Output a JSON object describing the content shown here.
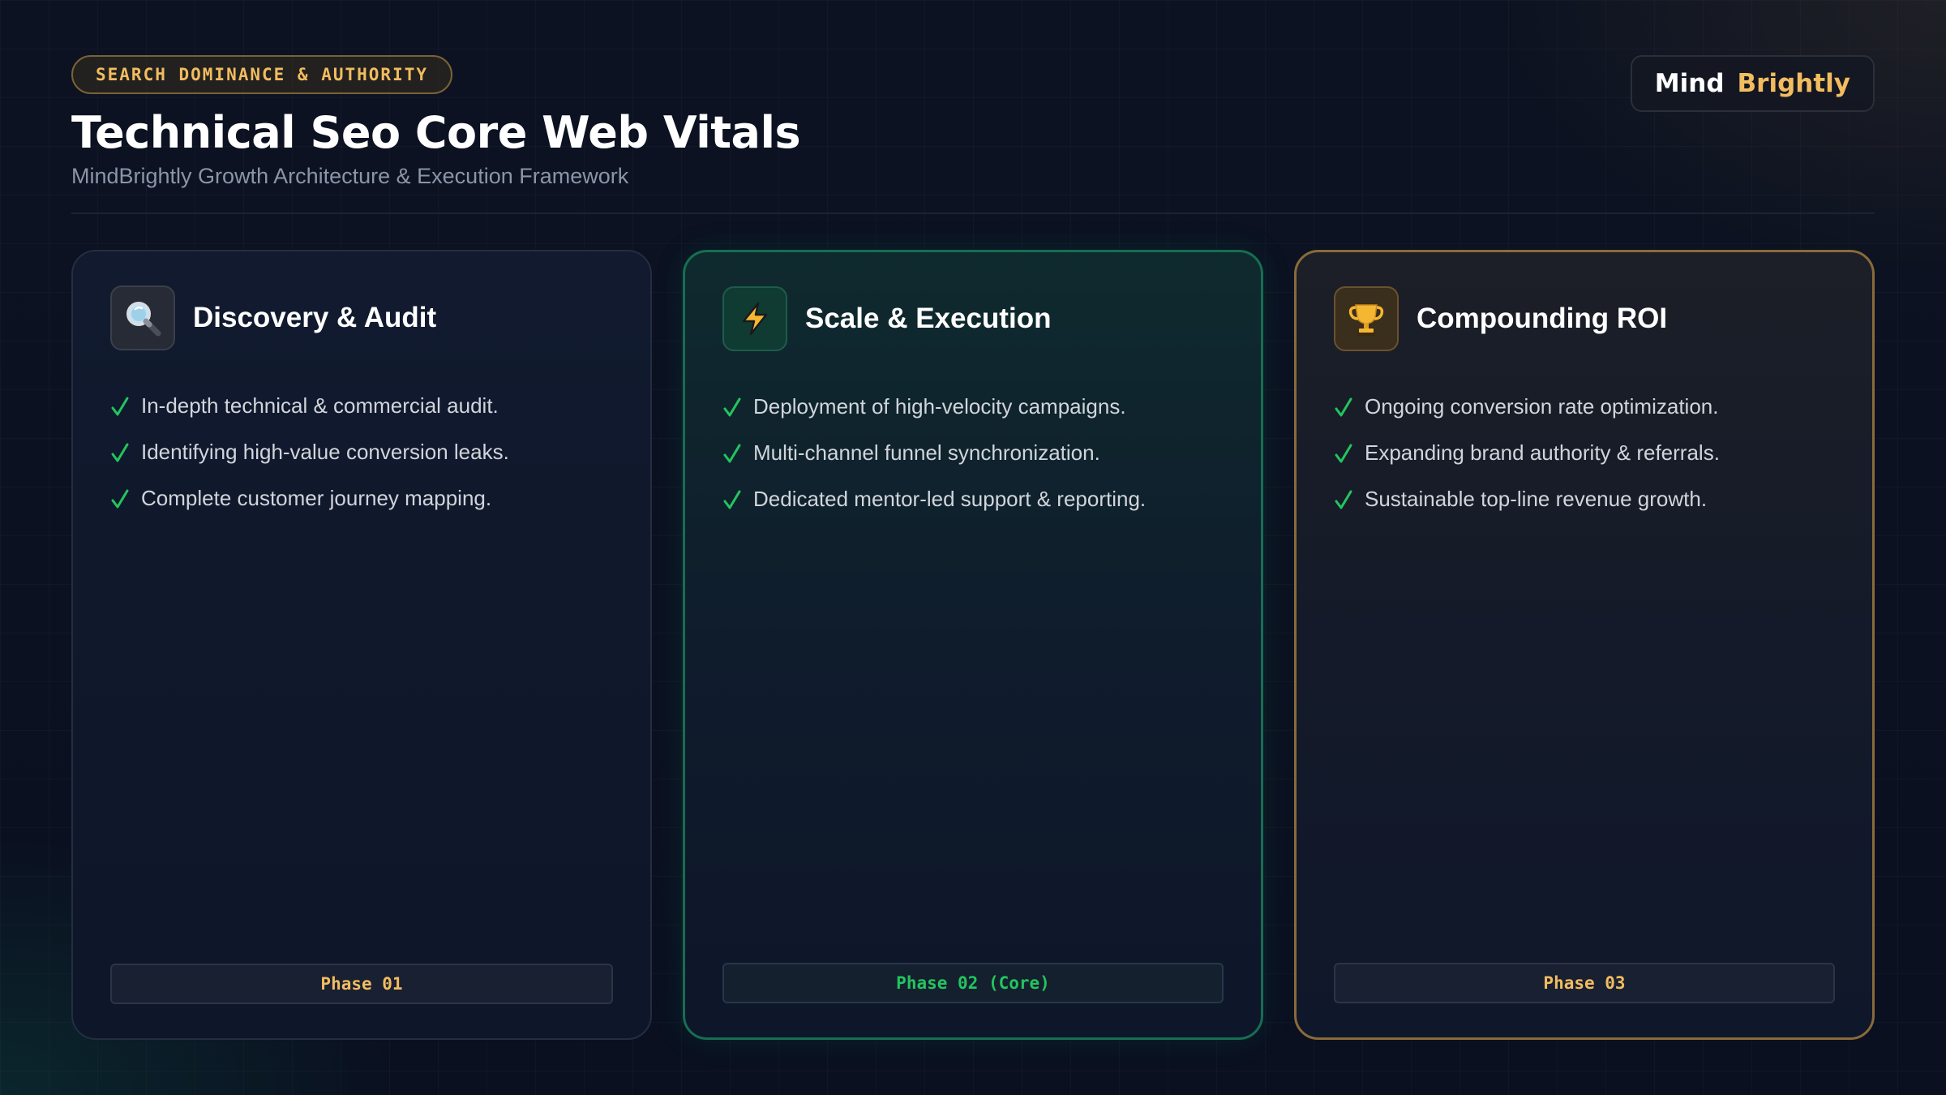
{
  "header": {
    "kicker": "SEARCH DOMINANCE & AUTHORITY",
    "title": "Technical Seo Core Web Vitals",
    "subtitle": "MindBrightly Growth Architecture & Execution Framework"
  },
  "logo": {
    "word1": "Mind",
    "word2": "Brightly"
  },
  "colors": {
    "accent_gold": "#f2bc5f",
    "accent_green": "#22c55e",
    "background": "#0b1120"
  },
  "cards": [
    {
      "icon": "magnifying-glass-icon",
      "title": "Discovery & Audit",
      "bullets": [
        "In-depth technical & commercial audit.",
        "Identifying high-value conversion leaks.",
        "Complete customer journey mapping."
      ],
      "phase": "Phase 01"
    },
    {
      "icon": "lightning-bolt-icon",
      "title": "Scale & Execution",
      "bullets": [
        "Deployment of high-velocity campaigns.",
        "Multi-channel funnel synchronization.",
        "Dedicated mentor-led support & reporting."
      ],
      "phase": "Phase 02 (Core)"
    },
    {
      "icon": "trophy-icon",
      "title": "Compounding ROI",
      "bullets": [
        "Ongoing conversion rate optimization.",
        "Expanding brand authority & referrals.",
        "Sustainable top-line revenue growth."
      ],
      "phase": "Phase 03"
    }
  ]
}
